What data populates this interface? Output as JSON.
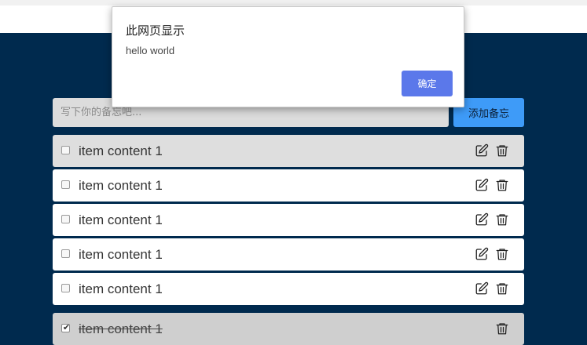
{
  "dialog": {
    "title": "此网页显示",
    "message": "hello world",
    "ok_label": "确定"
  },
  "memo": {
    "placeholder": "写下你的备忘吧...",
    "add_label": "添加备忘"
  },
  "todos": [
    {
      "text": "item content 1",
      "done": false
    },
    {
      "text": "item content 1",
      "done": false
    },
    {
      "text": "item content 1",
      "done": false
    },
    {
      "text": "item content 1",
      "done": false
    },
    {
      "text": "item content 1",
      "done": false
    },
    {
      "text": "item content 1",
      "done": true
    }
  ],
  "icons": {
    "edit": "edit-icon",
    "delete": "trash-icon"
  },
  "colors": {
    "page_background": "#002a4e",
    "add_button": "#3e9bf8",
    "dialog_ok": "#5b78ea"
  }
}
